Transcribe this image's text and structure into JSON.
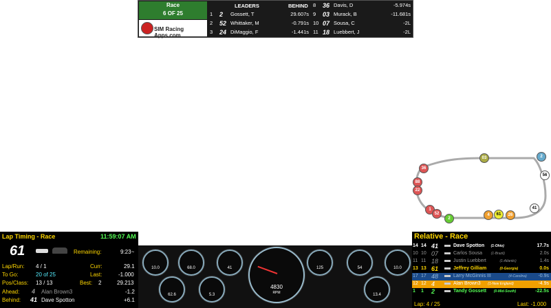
{
  "leaderboard": {
    "race_label": "Race",
    "lap_label": "6 OF 25",
    "logo_text": "SIM Racing Apps.com",
    "header_leaders": "LEADERS",
    "header_behind": "BEHIND",
    "left": [
      {
        "pos": "1",
        "num": "2",
        "name": "Gossett, T",
        "gap": "29.607s"
      },
      {
        "pos": "2",
        "num": "52",
        "name": "Whittaker, M",
        "gap": "-0.791s"
      },
      {
        "pos": "3",
        "num": "24",
        "name": "DiMaggio, F",
        "gap": "-1.441s"
      }
    ],
    "right": [
      {
        "pos": "8",
        "num": "36",
        "name": "Davis, D",
        "gap": "-5.974s"
      },
      {
        "pos": "9",
        "num": "03",
        "name": "Murack, B",
        "gap": "-11.681s"
      },
      {
        "pos": "10",
        "num": "07",
        "name": "Sousa, C",
        "gap": "-2L"
      },
      {
        "pos": "11",
        "num": "18",
        "name": "Luebbert, J",
        "gap": "-2L"
      }
    ]
  },
  "lap_timing": {
    "title": "Lap Timing - Race",
    "clock": "11:59:07 AM",
    "car_number": "61",
    "remaining_label": "Remaining:",
    "remaining_value": "9:23~",
    "laprun_label": "Lap/Run:",
    "laprun_value": "4 / 1",
    "curr_label": "Curr:",
    "curr_value": "29.1",
    "togo_label": "To Go:",
    "togo_value": "20 of 25",
    "last_label": "Last:",
    "last_value": "-1.000",
    "posclass_label": "Pos/Class:",
    "posclass_value": "13 / 13",
    "best_label": "Best:",
    "best_lap": "2",
    "best_value": "29.213",
    "ahead_label": "Ahead:",
    "ahead_num": "4",
    "ahead_name": "Alan Brown3",
    "ahead_gap": "-1.2",
    "behind_label": "Behind:",
    "behind_num": "41",
    "behind_name": "Dave Spotton",
    "behind_gap": "+6.1"
  },
  "dash": {
    "rpm_value": "4830",
    "rpm_label": "RPM",
    "gauges": [
      "10.0",
      "68.0",
      "41",
      "125",
      "54",
      "10.0",
      "62.6",
      "5.3",
      "13.4"
    ]
  },
  "relative": {
    "title": "Relative - Race",
    "rows": [
      {
        "pos": "14",
        "lap": "14",
        "num": "41",
        "name": "Dave Spotton",
        "sub": "(1-Ohio)",
        "gap": "17.7s",
        "style": "white"
      },
      {
        "pos": "10",
        "lap": "10",
        "num": "07",
        "name": "Carlos Sousa",
        "sub": "(1-Brazil)",
        "gap": "2.0s",
        "style": "gray"
      },
      {
        "pos": "11",
        "lap": "11",
        "num": "18",
        "name": "Justin Luebbert",
        "sub": "(1-Atlantic)",
        "gap": "1.4s",
        "style": "gray"
      },
      {
        "pos": "13",
        "lap": "13",
        "num": "61",
        "name": "Jeffrey Gilliam",
        "sub": "(0-Georgia)",
        "gap": "0.0s",
        "style": "yellow"
      },
      {
        "pos": "17",
        "lap": "17",
        "num": "48",
        "name": "Larry McGinnis III",
        "sub": "(4-Carolina)",
        "gap": "-0.9s",
        "style": "blue"
      },
      {
        "pos": "12",
        "lap": "12",
        "num": "4",
        "name": "Alan Brown3",
        "sub": "(1-New England)",
        "gap": "-4.9s",
        "style": "orange"
      },
      {
        "pos": "1",
        "lap": "1",
        "num": "2",
        "name": "Tandy Gossett",
        "sub": "(0-Mid-South)",
        "gap": "-22.5s",
        "style": "green"
      }
    ],
    "lap_text": "Lap: 4 / 25",
    "last_text": "Last: -1.000"
  },
  "track_cars": [
    {
      "num": "2",
      "color": "#6ac"
    },
    {
      "num": "56",
      "color": "#fff"
    },
    {
      "num": "41",
      "color": "#fff"
    },
    {
      "num": "03",
      "color": "#aa4"
    },
    {
      "num": "36",
      "color": "#d55"
    },
    {
      "num": "88",
      "color": "#d55"
    },
    {
      "num": "22",
      "color": "#d55"
    },
    {
      "num": "1",
      "color": "#d55"
    },
    {
      "num": "52",
      "color": "#d55"
    },
    {
      "num": "2",
      "color": "#6c3"
    },
    {
      "num": "4",
      "color": "#f0a030"
    },
    {
      "num": "61",
      "color": "#ee3"
    },
    {
      "num": "26",
      "color": "#f0a030"
    }
  ]
}
